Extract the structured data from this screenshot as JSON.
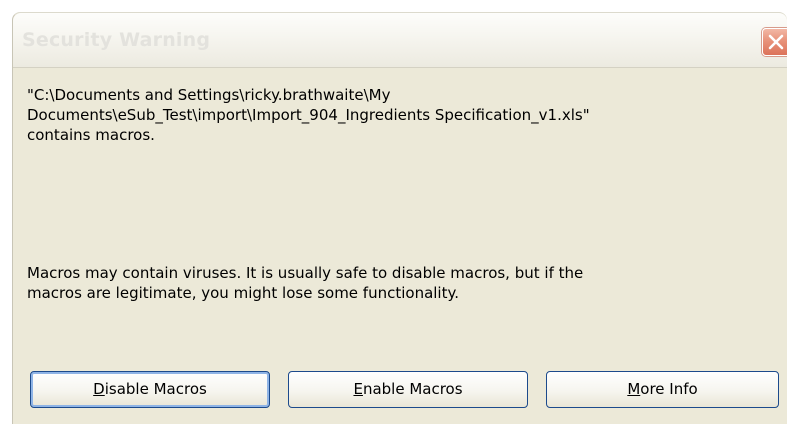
{
  "dialog": {
    "title": "Security Warning",
    "close_label": "×",
    "message": {
      "line1": "\"C:\\Documents and Settings\\ricky.brathwaite\\My",
      "line2": "Documents\\eSub_Test\\import\\Import_904_Ingredients Specification_v1.xls\"",
      "line3": "contains macros."
    },
    "warning": {
      "line1": "Macros may contain viruses. It is usually safe to disable macros, but if the",
      "line2": "macros are legitimate, you might lose some functionality."
    },
    "buttons": {
      "disable": {
        "key": "D",
        "rest": "isable Macros"
      },
      "enable": {
        "key": "E",
        "rest": "nable Macros"
      },
      "more": {
        "key": "M",
        "rest": "ore Info"
      }
    }
  },
  "colors": {
    "dialog_background": "#ece9d8",
    "close_button": "#e9967e",
    "button_border": "#1c4a8c",
    "title_text": "#e3e2dd"
  },
  "icons": {
    "close": "close-icon"
  }
}
